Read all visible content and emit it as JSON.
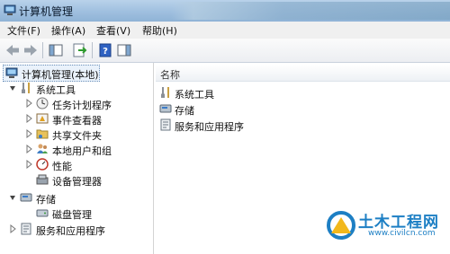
{
  "window": {
    "title": "计算机管理"
  },
  "menu": [
    "文件(F)",
    "操作(A)",
    "查看(V)",
    "帮助(H)"
  ],
  "toolbar": {
    "buttons": [
      "back-icon",
      "forward-icon",
      "show-hide-tree-icon",
      "export-list-icon",
      "help-icon",
      "show-hide-action-pane-icon"
    ]
  },
  "tree": {
    "root": "计算机管理(本地)",
    "system_tools": "系统工具",
    "children": [
      "任务计划程序",
      "事件查看器",
      "共享文件夹",
      "本地用户和组",
      "性能",
      "设备管理器"
    ],
    "storage": "存储",
    "disk_management": "磁盘管理",
    "services": "服务和应用程序"
  },
  "list": {
    "header": "名称",
    "rows": [
      "系统工具",
      "存储",
      "服务和应用程序"
    ]
  },
  "watermark": {
    "brand": "土木工程网",
    "url": "www.civilcn.com"
  },
  "colors": {
    "selection": "#eaf2fb",
    "accent": "#1d7fc4"
  }
}
